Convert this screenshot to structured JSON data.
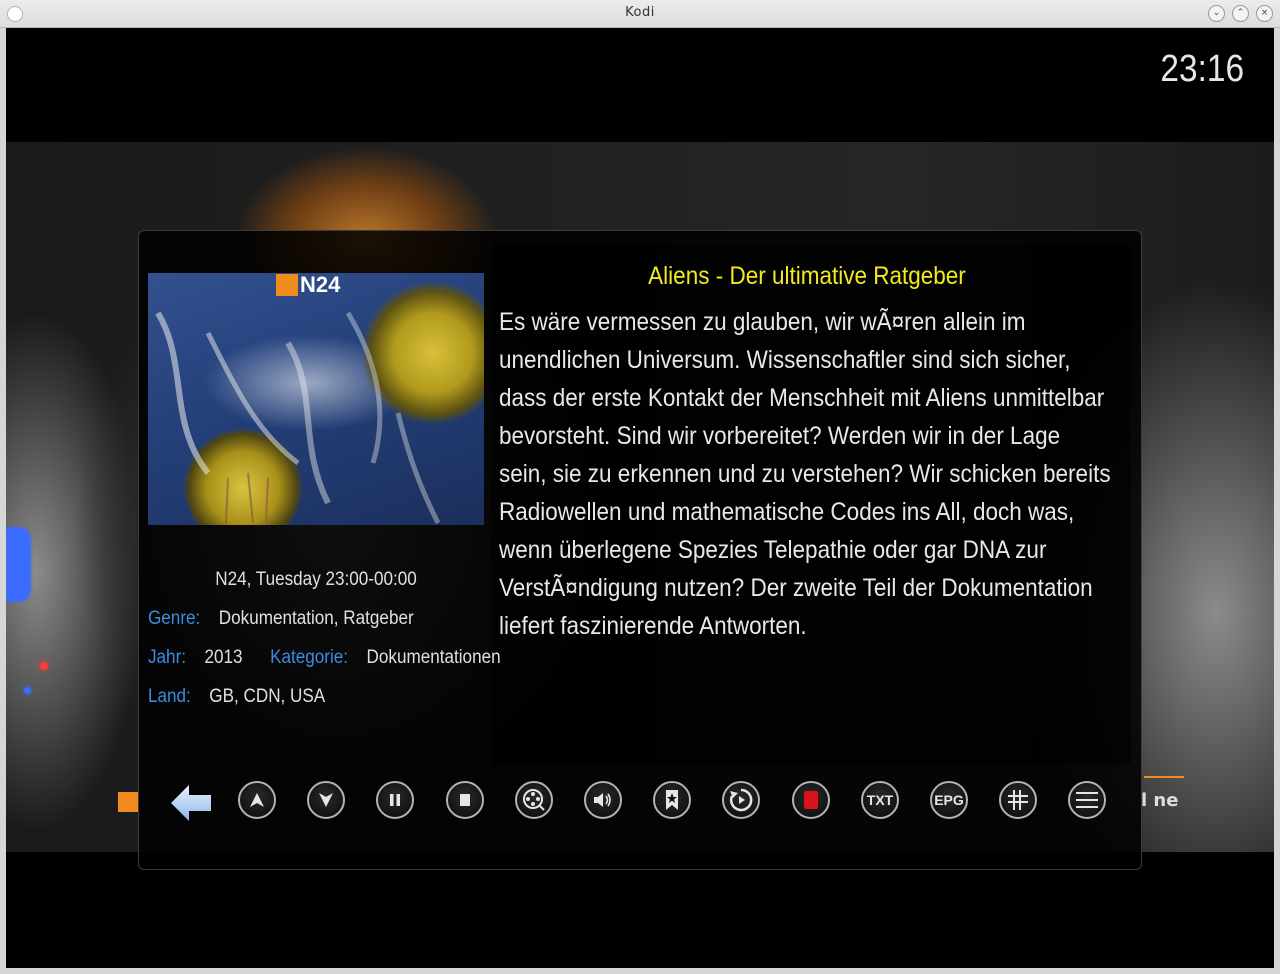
{
  "window": {
    "title": "Kodi"
  },
  "clock": "23:16",
  "video": {
    "channel_tail_text": "l ne"
  },
  "thumbnail": {
    "channel_logo_text": "N24"
  },
  "program": {
    "title": "Aliens - Der ultimative Ratgeber",
    "description": "Es wäre vermessen zu glauben, wir wÃ¤ren allein im unendlichen Universum. Wissenschaftler sind sich sicher, dass der erste Kontakt der Menschheit mit Aliens unmittelbar bevorsteht. Sind wir vorbereitet? Werden wir in der Lage sein, sie zu erkennen und zu verstehen? Wir schicken bereits Radiowellen und mathematische Codes ins All, doch was, wenn überlegene Spezies Telepathie oder gar DNA zur VerstÃ¤ndigung nutzen? Der zweite Teil der Dokumentation liefert faszinierende Antworten.",
    "channel_time": "N24, Tuesday 23:00-00:00",
    "genre_label": "Genre:",
    "genre": "Dokumentation, Ratgeber",
    "year_label": "Jahr:",
    "year": "2013",
    "category_label": "Kategorie:",
    "category": "Dokumentationen",
    "country_label": "Land:",
    "country": "GB, CDN, USA"
  },
  "controls": {
    "txt_label": "TXT",
    "epg_label": "EPG"
  },
  "colors": {
    "title_yellow": "#f2ea20",
    "label_blue": "#3a8de0",
    "record_red": "#d9131a",
    "n24_orange": "#f08b1d"
  }
}
